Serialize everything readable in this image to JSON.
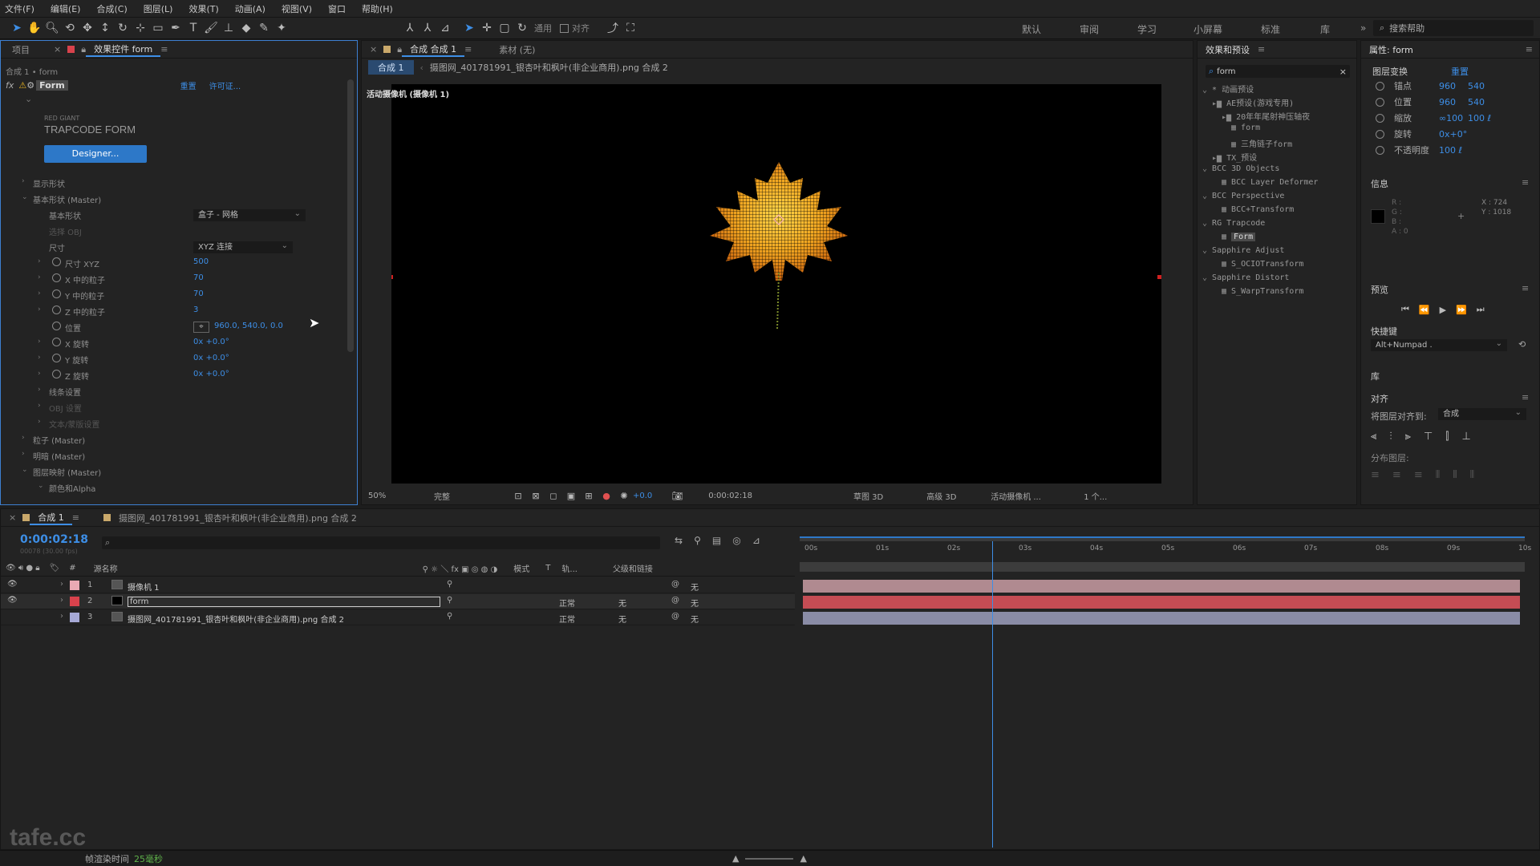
{
  "menu": [
    "文件(F)",
    "编辑(E)",
    "合成(C)",
    "图层(L)",
    "效果(T)",
    "动画(A)",
    "视图(V)",
    "窗口",
    "帮助(H)"
  ],
  "toolbar": {
    "universal_label": "通用",
    "align_label": "对齐",
    "workspaces": [
      "默认",
      "审阅",
      "学习",
      "小屏幕",
      "标准",
      "库"
    ],
    "search_help_placeholder": "搜索帮助"
  },
  "effect_panel": {
    "tabs": [
      "项目",
      "效果控件 form"
    ],
    "breadcrumb": "合成 1 • form",
    "effect_name": "Form",
    "reset_label": "重置",
    "license_label": "许可证...",
    "brand_small": "RED GIANT",
    "brand_large": "TRAPCODE FORM",
    "designer_button": "Designer...",
    "groups": {
      "display_shape": "显示形状",
      "base_form": "基本形状 (Master)",
      "base_form_label": "基本形状",
      "base_form_value": "盒子 - 网格",
      "string_settings": "选择 OBJ",
      "size_label": "尺寸",
      "size_value": "XYZ 连接",
      "size_xyz": "尺寸 XYZ",
      "size_xyz_val": "500",
      "x_particles": "X 中的粒子",
      "x_particles_val": "70",
      "y_particles": "Y 中的粒子",
      "y_particles_val": "70",
      "z_particles": "Z 中的粒子",
      "z_particles_val": "3",
      "position": "位置",
      "position_val": "960.0, 540.0, 0.0",
      "x_rot": "X 旋转",
      "x_rot_val": "0x +0.0°",
      "y_rot": "Y 旋转",
      "y_rot_val": "0x +0.0°",
      "z_rot": "Z 旋转",
      "z_rot_val": "0x +0.0°",
      "line_settings": "线条设置",
      "obj_settings": "OBJ 设置",
      "text_mask": "文本/蒙版设置",
      "particle": "粒子 (Master)",
      "shading": "明暗 (Master)",
      "layer_maps": "图层映射 (Master)",
      "color_alpha": "颜色和Alpha"
    }
  },
  "comp_panel": {
    "tab_label": "合成 合成 1",
    "footage_label": "素材 (无)",
    "nav_comp": "合成 1",
    "nav_footage": "摄图网_401781991_银杏叶和枫叶(非企业商用).png 合成 2",
    "camera_label": "活动摄像机 (摄像机 1)",
    "zoom": "50%",
    "quality": "完整",
    "exposure": "+0.0",
    "timecode": "0:00:02:18",
    "draft3d": "草图 3D",
    "renderer": "高级 3D",
    "view": "活动摄像机 ...",
    "views_count": "1 个..."
  },
  "effects_presets": {
    "title": "效果和预设",
    "search": "form",
    "tree": [
      {
        "text": "* 动画预设",
        "indent": 0
      },
      {
        "text": "AE预设(游戏专用)",
        "indent": 1
      },
      {
        "text": "20年年尾射神压轴夜",
        "indent": 2
      },
      {
        "text": "form",
        "indent": 3
      },
      {
        "text": "三角链子form",
        "indent": 3
      },
      {
        "text": "TX_预设",
        "indent": 1
      },
      {
        "text": "BCC 3D Objects",
        "indent": 0
      },
      {
        "text": "BCC Layer Deformer",
        "indent": 2
      },
      {
        "text": "BCC Perspective",
        "indent": 0
      },
      {
        "text": "BCC+Transform",
        "indent": 2
      },
      {
        "text": "RG Trapcode",
        "indent": 0
      },
      {
        "text": "Form",
        "indent": 2
      },
      {
        "text": "Sapphire Adjust",
        "indent": 0
      },
      {
        "text": "S_OCIOTransform",
        "indent": 2
      },
      {
        "text": "Sapphire Distort",
        "indent": 0
      },
      {
        "text": "S_WarpTransform",
        "indent": 2
      }
    ]
  },
  "props_panel": {
    "title": "属性: form",
    "transform": "图层变换",
    "reset": "重置",
    "props": [
      {
        "label": "锚点",
        "v1": "960",
        "v2": "540"
      },
      {
        "label": "位置",
        "v1": "960",
        "v2": "540"
      },
      {
        "label": "缩放",
        "v1": "∞100",
        "v2": "100 ℓ"
      },
      {
        "label": "旋转",
        "v1": "0x+0°",
        "v2": ""
      },
      {
        "label": "不透明度",
        "v1": "100 ℓ",
        "v2": ""
      }
    ],
    "info_title": "信息",
    "info_rgb": [
      "R :",
      "G :",
      "B :",
      "A : 0"
    ],
    "info_xy": [
      "X : 724",
      "Y : 1018"
    ],
    "preview_title": "预览",
    "shortcut_label": "快捷键",
    "shortcut_value": "Alt+Numpad .",
    "library_title": "库",
    "align_title": "对齐",
    "align_to_label": "将图层对齐到:",
    "align_to_value": "合成",
    "distribute_label": "分布图层:"
  },
  "timeline": {
    "tab_comp": "合成 1",
    "tab_footage": "摄图网_401781991_银杏叶和枫叶(非企业商用).png 合成 2",
    "timecode": "0:00:02:18",
    "fps_info": "00078 (30.00 fps)",
    "col_source": "源名称",
    "col_mode": "模式",
    "col_t": "T",
    "col_trkmat": "轨...",
    "col_parent": "父级和链接",
    "ruler": [
      "00s",
      "01s",
      "02s",
      "03s",
      "04s",
      "05s",
      "06s",
      "07s",
      "08s",
      "09s",
      "10s"
    ],
    "layers": [
      {
        "num": "1",
        "name": "摄像机 1",
        "color": "#e9a9b4",
        "track": "#b08a90",
        "mode": "",
        "parent": "无"
      },
      {
        "num": "2",
        "name": "form",
        "color": "#d8424c",
        "track": "#c54c54",
        "mode": "正常",
        "trk": "无",
        "parent": "无"
      },
      {
        "num": "3",
        "name": "摄图网_401781991_银杏叶和枫叶(非企业商用).png 合成 2",
        "color": "#a6a9d6",
        "track": "#8a8ca6",
        "mode": "正常",
        "trk": "无",
        "parent": "无"
      }
    ],
    "playhead_fraction": 0.263
  },
  "status": {
    "render_label": "帧渲染时间",
    "render_value": "25毫秒",
    "watermark": "tafe.cc"
  },
  "colors": {
    "accent": "#3d8ee6",
    "panel": "#232323",
    "bg": "#1d1d1d"
  }
}
